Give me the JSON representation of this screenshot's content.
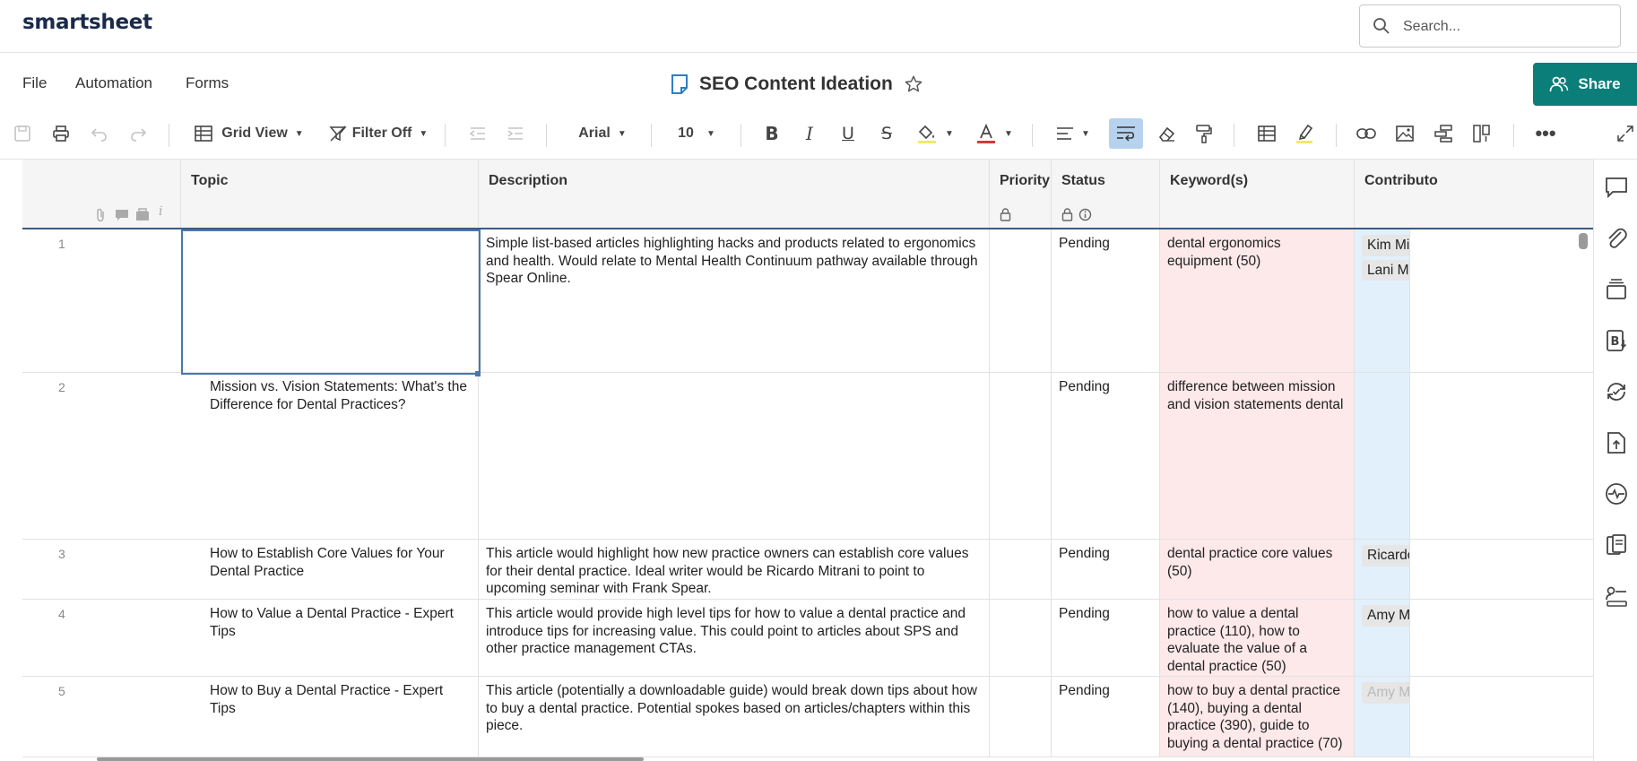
{
  "app": {
    "logo": "smartsheet"
  },
  "search": {
    "placeholder": "Search..."
  },
  "menu": {
    "file": "File",
    "automation": "Automation",
    "forms": "Forms"
  },
  "sheet": {
    "title": "SEO Content Ideation"
  },
  "share": {
    "label": "Share"
  },
  "toolbar": {
    "view": "Grid View",
    "filter": "Filter Off",
    "font": "Arial",
    "size": "10"
  },
  "columns": {
    "topic": "Topic",
    "description": "Description",
    "priority": "Priority",
    "status": "Status",
    "keywords": "Keyword(s)",
    "contributor": "Contributo"
  },
  "rows": [
    {
      "num": "1",
      "topic": "",
      "description": "Simple list-based articles highlighting hacks and products related to ergonomics and health. Would relate to Mental Health Continuum pathway available through Spear Online.",
      "priority": "",
      "status": "Pending",
      "keywords": "dental ergonomics equipment (50)",
      "contributors": [
        "Kim Mill",
        "Lani Mo"
      ]
    },
    {
      "num": "2",
      "topic": "Mission vs. Vision Statements: What's the Difference for Dental Practices?",
      "description": "",
      "priority": "",
      "status": "Pending",
      "keywords": "difference between mission and vision statements dental",
      "contributors": []
    },
    {
      "num": "3",
      "topic": "How to Establish Core Values for Your Dental Practice",
      "description": "This article would highlight how new practice owners can establish core values for their dental practice. Ideal writer would be Ricardo Mitrani to point to upcoming seminar with Frank Spear.",
      "priority": "",
      "status": "Pending",
      "keywords": "dental practice core values (50)",
      "contributors": [
        "Ricardo"
      ]
    },
    {
      "num": "4",
      "topic": "How to Value a Dental Practice - Expert Tips",
      "description": "This article would provide high level tips for how to value a dental practice and introduce tips for increasing value. This could point to articles about SPS and other practice management CTAs.",
      "priority": "",
      "status": "Pending",
      "keywords": "how to value a dental practice (110), how to evaluate the value of a dental practice (50)",
      "contributors": [
        "Amy Mo"
      ]
    },
    {
      "num": "5",
      "topic": "How to Buy a Dental Practice - Expert Tips",
      "description": "This article (potentially a downloadable guide) would break down tips about how to buy a dental practice. Potential spokes based on articles/chapters within this piece.",
      "priority": "",
      "status": "Pending",
      "keywords": "how to buy a dental practice (140), buying a dental practice (390), guide to buying a dental practice (70)",
      "contributors": [
        "Amy Mo"
      ]
    }
  ]
}
